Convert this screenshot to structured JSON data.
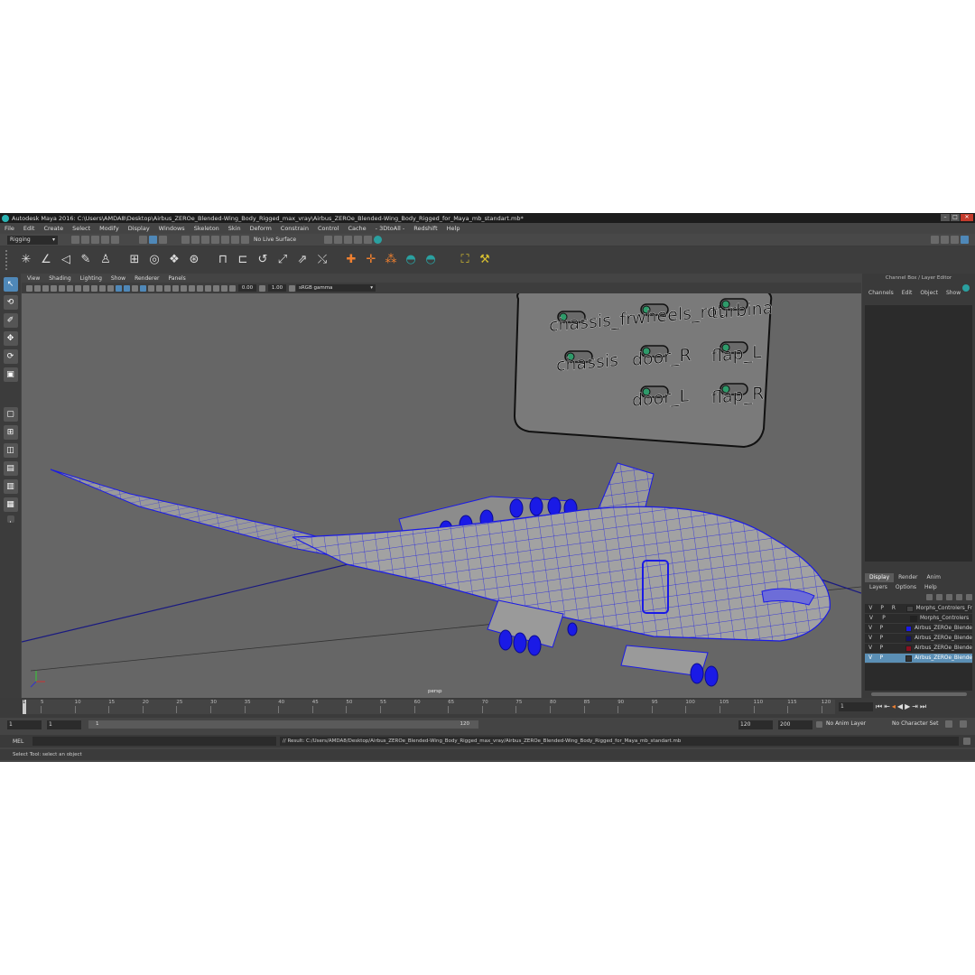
{
  "window": {
    "title": "Autodesk Maya 2016: C:\\Users\\AMDA8\\Desktop\\Airbus_ZEROe_Blended-Wing_Body_Rigged_max_vray\\Airbus_ZEROe_Blended-Wing_Body_Rigged_for_Maya_mb_standart.mb*"
  },
  "menu": [
    "File",
    "Edit",
    "Create",
    "Select",
    "Modify",
    "Display",
    "Windows",
    "Skeleton",
    "Skin",
    "Deform",
    "Constrain",
    "Control",
    "Cache",
    "- 3DtoAll -",
    "Redshift",
    "Help"
  ],
  "statusline": {
    "mode": "Rigging",
    "live_surface": "No Live Surface"
  },
  "shelf": {
    "icons": [
      "ik-handle-icon",
      "joint-icon",
      "bind-icon",
      "paint-weights-icon",
      "human-ik-icon",
      "cluster-icon",
      "lattice-icon",
      "wrap-icon",
      "blendshape-icon",
      "wire-icon",
      "parent-constraint-icon",
      "point-constraint-icon",
      "orient-constraint-icon",
      "scale-constraint-icon",
      "aim-constraint-icon",
      "pole-vector-icon",
      "locator-icon",
      "point-on-curve-icon",
      "set-key-icon",
      "graph-editor-icon"
    ]
  },
  "viewport": {
    "menu": [
      "View",
      "Shading",
      "Lighting",
      "Show",
      "Renderer",
      "Panels"
    ],
    "exposure": "0.00",
    "gamma": "1.00",
    "colorspace": "sRGB gamma",
    "camera": "persp",
    "controls": [
      "chassis_fr",
      "wheels_rot",
      "turbina",
      "chassis",
      "door_R",
      "flap_L",
      "door_L",
      "flap_R"
    ]
  },
  "channelbox": {
    "title": "Channel Box / Layer Editor",
    "menu": [
      "Channels",
      "Edit",
      "Object",
      "Show"
    ]
  },
  "layers": {
    "tabs": [
      "Display",
      "Render",
      "Anim"
    ],
    "menu": [
      "Layers",
      "Options",
      "Help"
    ],
    "rows": [
      {
        "v": "V",
        "p": "P",
        "r": "R",
        "color": "#444444",
        "name": "Morphs_Controlers_Fr"
      },
      {
        "v": "V",
        "p": "P",
        "r": "",
        "color": "#222222",
        "name": "Morphs_Controlers"
      },
      {
        "v": "V",
        "p": "P",
        "r": "",
        "color": "#1a1ae6",
        "name": "Airbus_ZEROe_Blende"
      },
      {
        "v": "V",
        "p": "P",
        "r": "",
        "color": "#141466",
        "name": "Airbus_ZEROe_Blende"
      },
      {
        "v": "V",
        "p": "P",
        "r": "",
        "color": "#8a1020",
        "name": "Airbus_ZEROe_Blende"
      },
      {
        "v": "V",
        "p": "P",
        "r": "",
        "color": "#333333",
        "name": "Airbus_ZEROe_Blende"
      }
    ]
  },
  "timeline": {
    "ticks": [
      "5",
      "10",
      "15",
      "20",
      "25",
      "30",
      "35",
      "40",
      "45",
      "50",
      "55",
      "60",
      "65",
      "70",
      "75",
      "80",
      "85",
      "90",
      "95",
      "100",
      "105",
      "110",
      "115",
      "120"
    ],
    "current": "1",
    "start_marker": "1"
  },
  "range": {
    "start": "1",
    "anim_start": "1",
    "slider_start": "1",
    "slider_end": "120",
    "end": "120",
    "anim_end": "200",
    "anim_layer": "No Anim Layer",
    "character_set": "No Character Set"
  },
  "cmd": {
    "lang": "MEL",
    "result": "// Result: C:/Users/AMDA8/Desktop/Airbus_ZEROe_Blended-Wing_Body_Rigged_max_vray/Airbus_ZEROe_Blended-Wing_Body_Rigged_for_Maya_mb_standart.mb"
  },
  "help": "Select Tool: select an object",
  "colors": {
    "wire": "#1a1ae6",
    "mesh": "#9a9a9a",
    "viewport_bg": "#666666",
    "selected": "#5b8fb5"
  }
}
